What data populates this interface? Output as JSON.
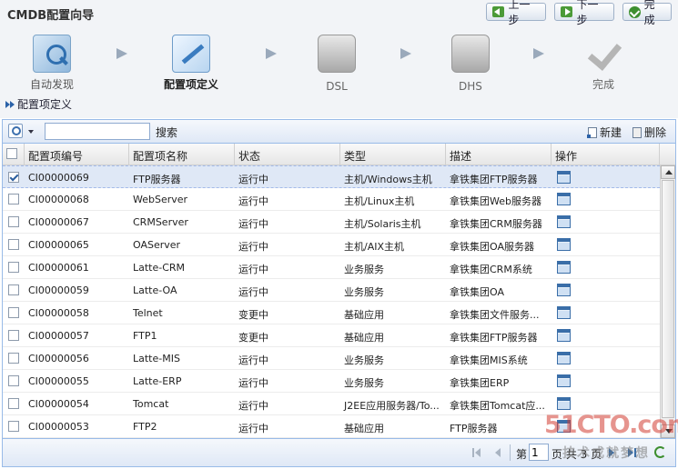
{
  "app": {
    "title": "CMDB配置向导"
  },
  "nav": {
    "prev_label": "上一步",
    "next_label": "下一步",
    "finish_label": "完成"
  },
  "steps": [
    {
      "label": "自动发现",
      "icon": "auto-discover-icon",
      "state": "done"
    },
    {
      "label": "配置项定义",
      "icon": "ci-define-icon",
      "state": "active"
    },
    {
      "label": "DSL",
      "icon": "dsl-icon",
      "state": "disabled"
    },
    {
      "label": "DHS",
      "icon": "dhs-icon",
      "state": "disabled"
    },
    {
      "label": "完成",
      "icon": "checkmark-icon",
      "state": "disabled"
    }
  ],
  "breadcrumb": {
    "label": "配置项定义"
  },
  "toolbar": {
    "search_value": "",
    "search_label": "搜索",
    "new_label": "新建",
    "delete_label": "删除"
  },
  "grid": {
    "columns": [
      "配置项编号",
      "配置项名称",
      "状态",
      "类型",
      "描述",
      "操作"
    ],
    "rows": [
      {
        "checked": true,
        "id": "CI00000069",
        "name": "FTP服务器",
        "status": "运行中",
        "type": "主机/Windows主机",
        "desc": "拿铁集团FTP服务器"
      },
      {
        "checked": false,
        "id": "CI00000068",
        "name": "WebServer",
        "status": "运行中",
        "type": "主机/Linux主机",
        "desc": "拿铁集团Web服务器"
      },
      {
        "checked": false,
        "id": "CI00000067",
        "name": "CRMServer",
        "status": "运行中",
        "type": "主机/Solaris主机",
        "desc": "拿铁集团CRM服务器"
      },
      {
        "checked": false,
        "id": "CI00000065",
        "name": "OAServer",
        "status": "运行中",
        "type": "主机/AIX主机",
        "desc": "拿铁集团OA服务器"
      },
      {
        "checked": false,
        "id": "CI00000061",
        "name": "Latte-CRM",
        "status": "运行中",
        "type": "业务服务",
        "desc": "拿铁集团CRM系统"
      },
      {
        "checked": false,
        "id": "CI00000059",
        "name": "Latte-OA",
        "status": "运行中",
        "type": "业务服务",
        "desc": "拿铁集团OA"
      },
      {
        "checked": false,
        "id": "CI00000058",
        "name": "Telnet",
        "status": "变更中",
        "type": "基础应用",
        "desc": "拿铁集团文件服务..."
      },
      {
        "checked": false,
        "id": "CI00000057",
        "name": "FTP1",
        "status": "变更中",
        "type": "基础应用",
        "desc": "拿铁集团FTP服务器"
      },
      {
        "checked": false,
        "id": "CI00000056",
        "name": "Latte-MIS",
        "status": "运行中",
        "type": "业务服务",
        "desc": "拿铁集团MIS系统"
      },
      {
        "checked": false,
        "id": "CI00000055",
        "name": "Latte-ERP",
        "status": "运行中",
        "type": "业务服务",
        "desc": "拿铁集团ERP"
      },
      {
        "checked": false,
        "id": "CI00000054",
        "name": "Tomcat",
        "status": "运行中",
        "type": "J2EE应用服务器/To...",
        "desc": "拿铁集团Tomcat应..."
      },
      {
        "checked": false,
        "id": "CI00000053",
        "name": "FTP2",
        "status": "运行中",
        "type": "基础应用",
        "desc": "FTP服务器"
      }
    ]
  },
  "pager": {
    "page_prefix": "第",
    "current_page": "1",
    "page_suffix": "页 共 3 页"
  },
  "watermark": {
    "main": "51CTO.com",
    "sub": "技术成就梦想"
  }
}
